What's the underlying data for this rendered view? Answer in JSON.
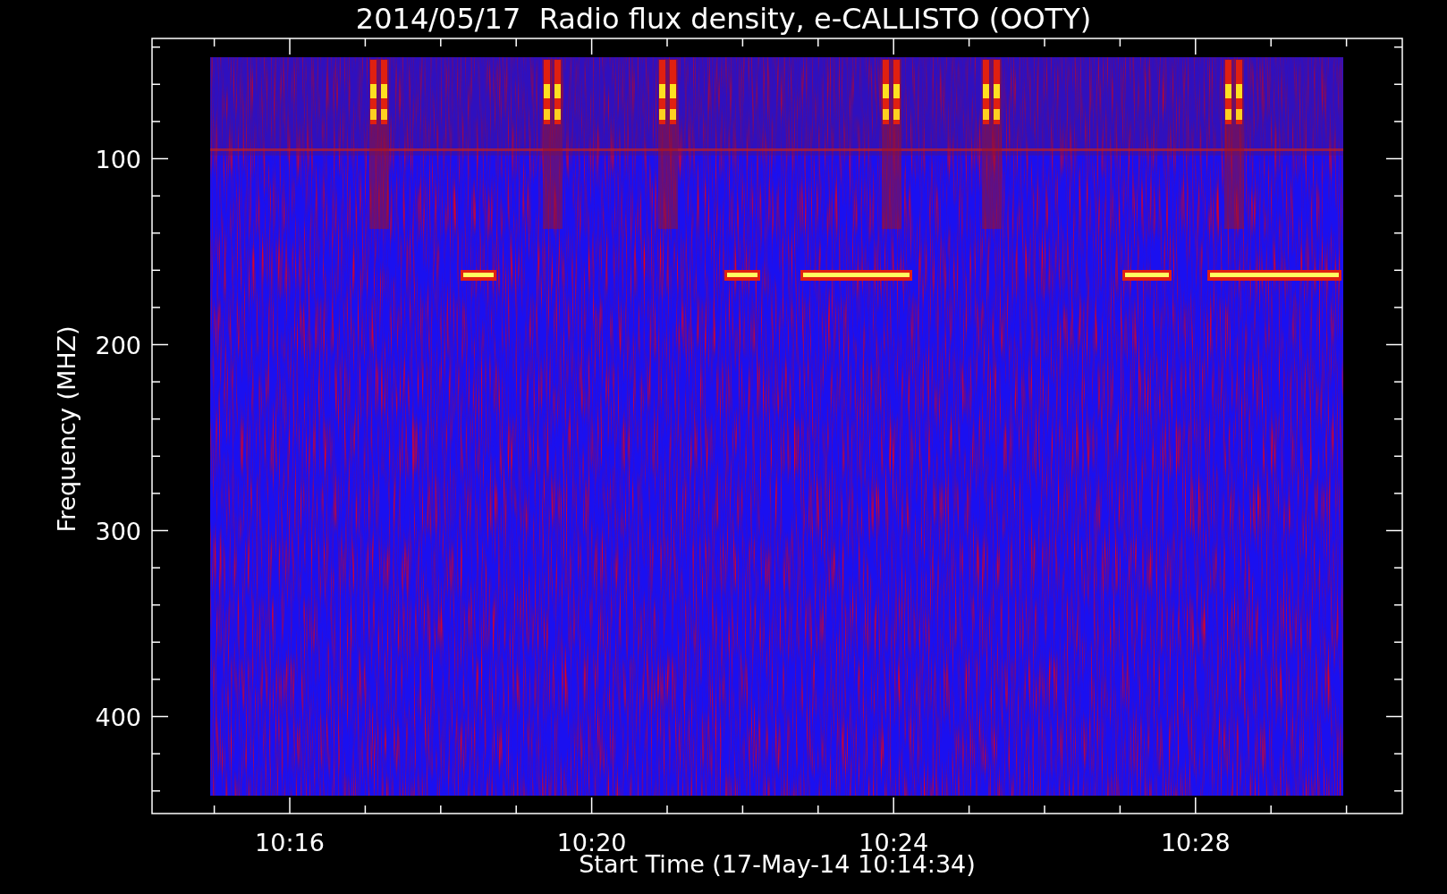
{
  "title": "2014/05/17  Radio flux density, e-CALLISTO (OOTY)",
  "plot": {
    "xlabel": "Start Time (17-May-14 10:14:34)",
    "ylabel": "Frequency (MHZ)",
    "xticks": [
      "10:16",
      "10:20",
      "10:24",
      "10:28"
    ],
    "yticks": [
      "100",
      "200",
      "300",
      "400"
    ]
  }
}
